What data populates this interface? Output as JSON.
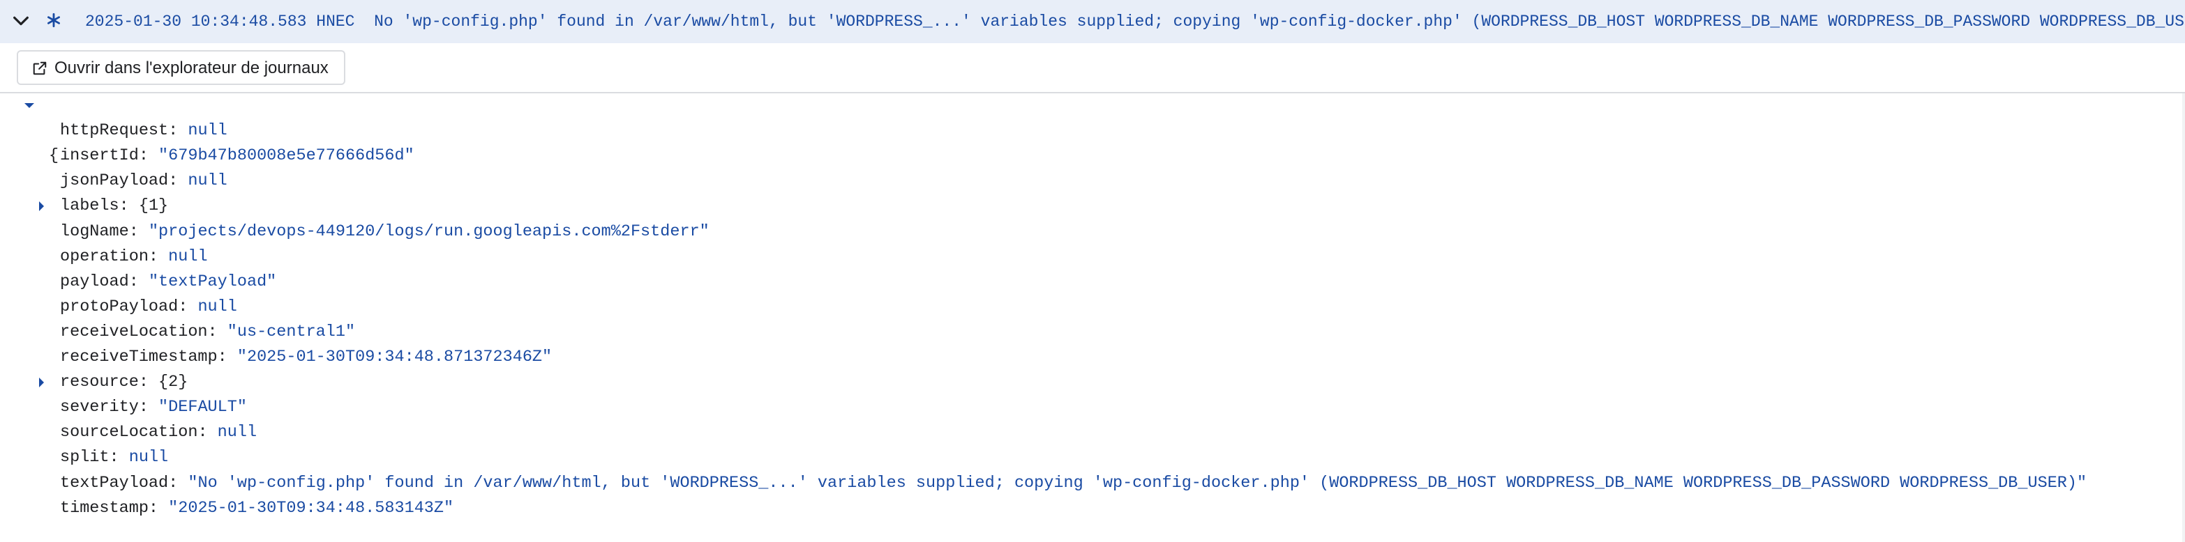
{
  "summary": {
    "timestamp": "2025-01-30 10:34:48.583",
    "tz": "HNEC",
    "message": "No 'wp-config.php' found in /var/www/html, but 'WORDPRESS_...' variables supplied; copying 'wp-config-docker.php' (WORDPRESS_DB_HOST WORDPRESS_DB_NAME WORDPRESS_DB_PASSWORD WORDPRESS_DB_USER)",
    "severity_icon": "asterisk-default-severity-icon",
    "collapse_icon": "chevron-down-icon"
  },
  "actions": {
    "open_in_logs_explorer": "Ouvrir dans l'explorateur de journaux",
    "open_icon": "open-in-new-icon"
  },
  "tree": {
    "open_brace": "{",
    "fields": [
      {
        "key": "httpRequest",
        "value": "null",
        "kind": "kw"
      },
      {
        "key": "insertId",
        "value": "\"679b47b80008e5e77666d56d\"",
        "kind": "str"
      },
      {
        "key": "jsonPayload",
        "value": "null",
        "kind": "kw"
      },
      {
        "key": "labels",
        "value": "{1}",
        "kind": "meta",
        "expandable": true
      },
      {
        "key": "logName",
        "value": "\"projects/devops-449120/logs/run.googleapis.com%2Fstderr\"",
        "kind": "str"
      },
      {
        "key": "operation",
        "value": "null",
        "kind": "kw"
      },
      {
        "key": "payload",
        "value": "\"textPayload\"",
        "kind": "str"
      },
      {
        "key": "protoPayload",
        "value": "null",
        "kind": "kw"
      },
      {
        "key": "receiveLocation",
        "value": "\"us-central1\"",
        "kind": "str"
      },
      {
        "key": "receiveTimestamp",
        "value": "\"2025-01-30T09:34:48.871372346Z\"",
        "kind": "str"
      },
      {
        "key": "resource",
        "value": "{2}",
        "kind": "meta",
        "expandable": true
      },
      {
        "key": "severity",
        "value": "\"DEFAULT\"",
        "kind": "str"
      },
      {
        "key": "sourceLocation",
        "value": "null",
        "kind": "kw"
      },
      {
        "key": "split",
        "value": "null",
        "kind": "kw"
      },
      {
        "key": "textPayload",
        "value": "\"No 'wp-config.php' found in /var/www/html, but 'WORDPRESS_...' variables supplied; copying 'wp-config-docker.php' (WORDPRESS_DB_HOST WORDPRESS_DB_NAME WORDPRESS_DB_PASSWORD WORDPRESS_DB_USER)\"",
        "kind": "str"
      },
      {
        "key": "timestamp",
        "value": "\"2025-01-30T09:34:48.583143Z\"",
        "kind": "str"
      }
    ]
  },
  "colors": {
    "accent": "#1a4ba3",
    "summary_bg": "#e8eef8",
    "border": "#dadce0"
  }
}
